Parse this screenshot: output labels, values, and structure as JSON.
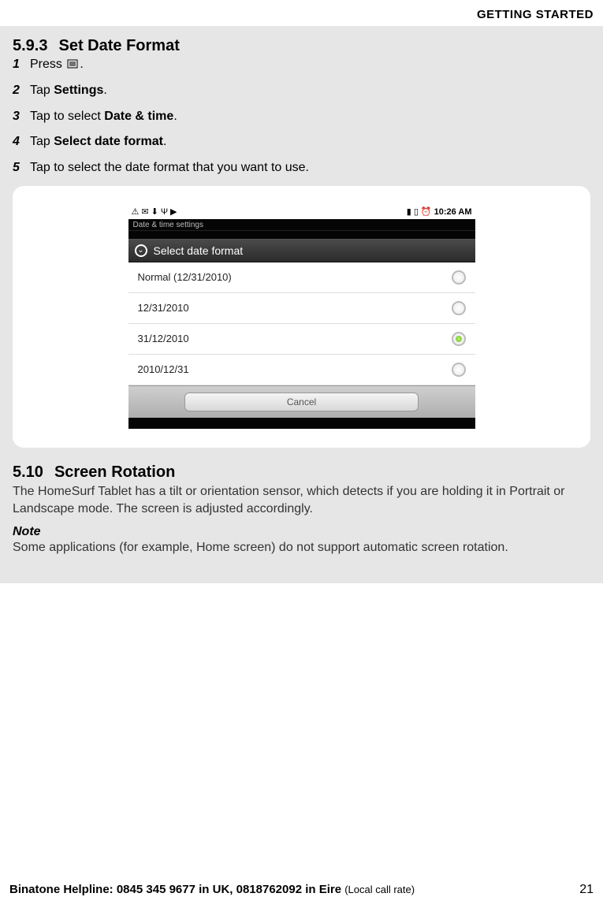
{
  "header": {
    "title": "GETTING STARTED"
  },
  "section1": {
    "number": "5.9.3",
    "title": "Set Date Format",
    "steps": [
      {
        "n": "1",
        "prefix": "Press ",
        "bold": "",
        "suffix": ".",
        "icon": true
      },
      {
        "n": "2",
        "prefix": "Tap ",
        "bold": "Settings",
        "suffix": "."
      },
      {
        "n": "3",
        "prefix": "Tap to select ",
        "bold": "Date & time",
        "suffix": "."
      },
      {
        "n": "4",
        "prefix": "Tap ",
        "bold": "Select date format",
        "suffix": "."
      },
      {
        "n": "5",
        "prefix": "Tap to select the date format that you want to use.",
        "bold": "",
        "suffix": ""
      }
    ]
  },
  "screenshot": {
    "status_time": "10:26 AM",
    "subtitle": "Date & time settings",
    "dialog_title": "Select date format",
    "options": [
      {
        "label": "Normal (12/31/2010)",
        "selected": false
      },
      {
        "label": "12/31/2010",
        "selected": false
      },
      {
        "label": "31/12/2010",
        "selected": true
      },
      {
        "label": "2010/12/31",
        "selected": false
      }
    ],
    "cancel": "Cancel"
  },
  "section2": {
    "number": "5.10",
    "title": "Screen Rotation",
    "body": "The HomeSurf Tablet has a tilt or orientation sensor, which detects if you are holding it in Portrait or Landscape mode. The screen is adjusted accordingly.",
    "note_label": "Note",
    "note_body": "Some applications (for example, Home screen) do not support automatic screen rotation."
  },
  "footer": {
    "helpline_bold": "Binatone Helpline: 0845 345 9677 in UK, 0818762092 in Eire ",
    "helpline_rate": "(Local call rate)",
    "page": "21"
  }
}
